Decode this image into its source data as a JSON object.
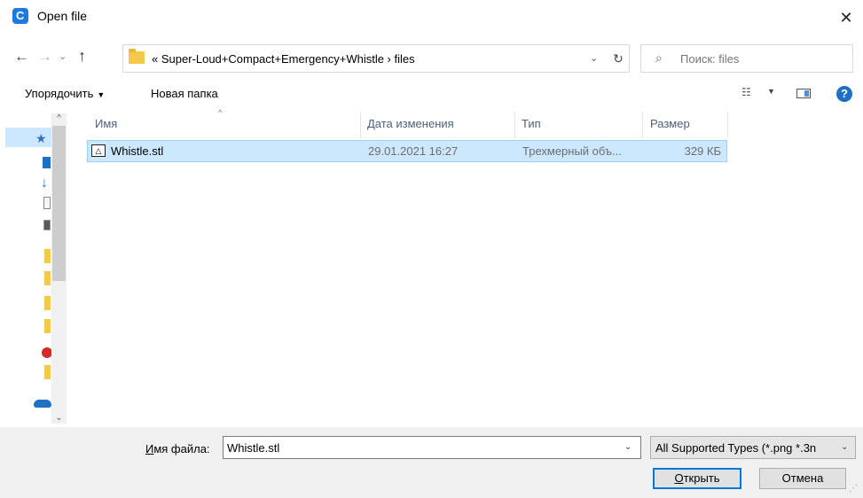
{
  "window": {
    "title": "Open file",
    "close_glyph": "✕",
    "app_icon_letter": "C"
  },
  "nav": {
    "back_glyph": "←",
    "forward_glyph": "→",
    "recent_glyph": "⌄",
    "up_glyph": "↑"
  },
  "address": {
    "path": "«  Super-Loud+Compact+Emergency+Whistle  ›  files",
    "dropdown_glyph": "⌄",
    "refresh_glyph": "↻"
  },
  "search": {
    "placeholder": "Поиск: files",
    "icon_glyph": "⌕"
  },
  "toolbar": {
    "organize_label": "Упорядочить",
    "organize_caret": "▼",
    "new_folder_label": "Новая папка",
    "view_glyph": "☷",
    "view_caret": "▼",
    "help_glyph": "?"
  },
  "columns": {
    "name": "Имя",
    "date": "Дата изменения",
    "type": "Тип",
    "size": "Размер",
    "sort_glyph": "^"
  },
  "files": [
    {
      "name": "Whistle.stl",
      "date": "29.01.2021 16:27",
      "type": "Трехмерный объ...",
      "size": "329 КБ",
      "icon": "3d-object-icon",
      "selected": true
    }
  ],
  "sidebar": {
    "scroll_up_glyph": "^",
    "scroll_down_glyph": "⌄",
    "icons": [
      "pin-icon",
      "desktop-icon",
      "download-icon",
      "document-icon",
      "pictures-icon",
      "folder-icon",
      "warning-icon",
      "onedrive-icon"
    ]
  },
  "footer": {
    "filename_label_prefix": "И",
    "filename_label_rest": "мя файла:",
    "filename_value": "Whistle.stl",
    "filename_dropdown_glyph": "⌄",
    "filter_value": "All Supported Types (*.png *.3n",
    "filter_dropdown_glyph": "⌄",
    "open_label_prefix": "О",
    "open_label_rest": "ткрыть",
    "cancel_label": "Отмена"
  },
  "colors": {
    "selection_bg": "#cce8ff",
    "selection_border": "#99d1ff",
    "accent": "#0078d7"
  }
}
